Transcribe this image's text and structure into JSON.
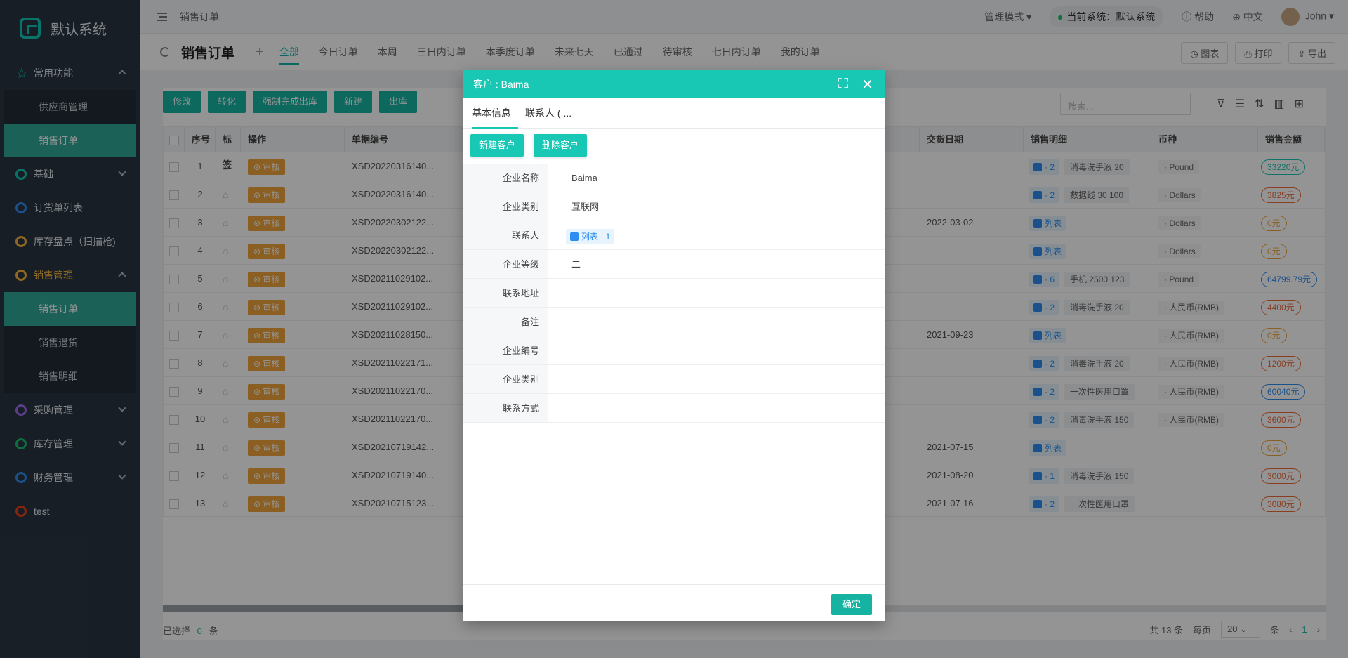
{
  "sidebar": {
    "brand": "默认系统",
    "groups": [
      {
        "label": "常用功能",
        "color": "#11c7b5"
      },
      {
        "label": "基础",
        "color": "#11c7b5"
      },
      {
        "label": "订货单列表",
        "color": "#2d8cf0"
      },
      {
        "label": "库存盘点（扫描枪)",
        "color": "#f6b43c"
      },
      {
        "label": "销售管理",
        "color": "#f6b43c"
      },
      {
        "label": "采购管理",
        "color": "#9b6cf0"
      },
      {
        "label": "库存管理",
        "color": "#19be6b"
      },
      {
        "label": "财务管理",
        "color": "#2d8cf0"
      },
      {
        "label": "test",
        "color": "#ed4014"
      }
    ],
    "common_sub": [
      "供应商管理",
      "销售订单"
    ],
    "sales_sub": [
      "销售订单",
      "销售退货",
      "销售明细"
    ]
  },
  "topbar": {
    "breadcrumb": "销售订单",
    "mode": "管理模式",
    "current_system": "当前系统：默认系统",
    "help": "帮助",
    "lang": "中文",
    "user": "John"
  },
  "tabbar": {
    "title": "销售订单",
    "tabs": [
      "全部",
      "今日订单",
      "本周",
      "三日内订单",
      "本季度订单",
      "未来七天",
      "已通过",
      "待审核",
      "七日内订单",
      "我的订单"
    ],
    "actions": [
      "图表",
      "打印",
      "导出"
    ]
  },
  "toolbar": {
    "buttons": [
      "修改",
      "转化",
      "强制完成出库",
      "新建",
      "出库"
    ],
    "search_placeholder": "搜索..."
  },
  "grid": {
    "headers": [
      "序号",
      "标签",
      "操作",
      "单据编号",
      "交货日期",
      "销售明细",
      "币种",
      "销售金额"
    ],
    "audit_label": "审核",
    "list_label": "列表",
    "rows": [
      {
        "no": "1",
        "code": "XSD20220316140...",
        "date": "",
        "detail_count": "2",
        "detail_name": "消毒洗手液 20",
        "cur": "Pound",
        "amt": "33220元",
        "amt_color": "#19c7b5"
      },
      {
        "no": "2",
        "code": "XSD20220316140...",
        "date": "",
        "detail_count": "2",
        "detail_name": "数据线 30 100",
        "cur": "Dollars",
        "amt": "3825元",
        "amt_color": "#ed6a3a"
      },
      {
        "no": "3",
        "code": "XSD20220302122...",
        "date": "2022-03-02",
        "detail_count": "",
        "detail_name": "",
        "cur": "Dollars",
        "amt": "0元",
        "amt_color": "#f0a23a"
      },
      {
        "no": "4",
        "code": "XSD20220302122...",
        "date": "",
        "detail_count": "",
        "detail_name": "",
        "cur": "Dollars",
        "amt": "0元",
        "amt_color": "#f0a23a"
      },
      {
        "no": "5",
        "code": "XSD20211029102...",
        "date": "",
        "detail_count": "6",
        "detail_name": "手机 2500 123",
        "cur": "Pound",
        "amt": "64799.79元",
        "amt_color": "#2d8cf0"
      },
      {
        "no": "6",
        "code": "XSD20211029102...",
        "date": "",
        "detail_count": "2",
        "detail_name": "消毒洗手液 20",
        "cur": "人民币(RMB)",
        "amt": "4400元",
        "amt_color": "#ed6a3a"
      },
      {
        "no": "7",
        "code": "XSD20211028150...",
        "date": "2021-09-23",
        "detail_count": "",
        "detail_name": "",
        "cur": "人民币(RMB)",
        "amt": "0元",
        "amt_color": "#f0a23a"
      },
      {
        "no": "8",
        "code": "XSD20211022171...",
        "date": "",
        "detail_count": "2",
        "detail_name": "消毒洗手液 20",
        "cur": "人民币(RMB)",
        "amt": "1200元",
        "amt_color": "#ed6a3a"
      },
      {
        "no": "9",
        "code": "XSD20211022170...",
        "date": "",
        "detail_count": "2",
        "detail_name": "一次性医用口罩",
        "cur": "人民币(RMB)",
        "amt": "60040元",
        "amt_color": "#2d8cf0"
      },
      {
        "no": "10",
        "code": "XSD20211022170...",
        "date": "",
        "detail_count": "2",
        "detail_name": "消毒洗手液 150",
        "cur": "人民币(RMB)",
        "amt": "3600元",
        "amt_color": "#ed6a3a"
      },
      {
        "no": "11",
        "code": "XSD20210719142...",
        "date": "2021-07-15",
        "detail_count": "",
        "detail_name": "",
        "cur": "",
        "amt": "0元",
        "amt_color": "#f0a23a"
      },
      {
        "no": "12",
        "code": "XSD20210719140...",
        "date": "2021-08-20",
        "detail_count": "1",
        "detail_name": "消毒洗手液 150",
        "cur": "",
        "amt": "3000元",
        "amt_color": "#ed6a3a"
      },
      {
        "no": "13",
        "code": "XSD20210715123...",
        "date": "2021-07-16",
        "detail_count": "2",
        "detail_name": "一次性医用口罩",
        "cur": "",
        "amt": "3080元",
        "amt_color": "#ed6a3a"
      }
    ]
  },
  "footer": {
    "selected_prefix": "已选择",
    "selected_count": "0",
    "selected_suffix": "条",
    "total": "共 13 条",
    "per_page_label": "每页",
    "per_page": "20",
    "per_page_suffix": "条",
    "page": "1"
  },
  "modal": {
    "title": "客户 : Baima",
    "tabs": [
      "基本信息",
      "联系人 ( ..."
    ],
    "buttons": [
      "新建客户",
      "删除客户"
    ],
    "fields": [
      {
        "label": "企业名称",
        "value": "Baima"
      },
      {
        "label": "企业类别",
        "value": "互联网"
      },
      {
        "label": "联系人",
        "value": "列表 · 1"
      },
      {
        "label": "企业等级",
        "value": "二"
      },
      {
        "label": "联系地址",
        "value": ""
      },
      {
        "label": "备注",
        "value": ""
      },
      {
        "label": "企业编号",
        "value": ""
      },
      {
        "label": "企业类别",
        "value": ""
      },
      {
        "label": "联系方式",
        "value": ""
      }
    ],
    "ok": "确定"
  }
}
